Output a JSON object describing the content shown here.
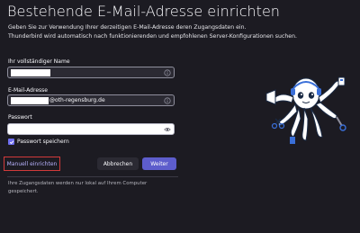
{
  "header": {
    "title": "Bestehende E-Mail-Adresse einrichten",
    "intro_line1": "Geben Sie zur Verwendung Ihrer derzeitigen E-Mail-Adresse deren Zugangsdaten ein.",
    "intro_line2": "Thunderbird wird automatisch nach funktionierenden und empfohlenen Server-Konfigurationen suchen."
  },
  "form": {
    "name_label": "Ihr vollständiger Name",
    "email_label": "E-Mail-Adresse",
    "email_domain": "@oth-regensburg.de",
    "password_label": "Passwort",
    "remember_label": "Passwort speichern",
    "remember_checked": true
  },
  "actions": {
    "manual_label": "Manuell einrichten",
    "cancel_label": "Abbrechen",
    "next_label": "Weiter"
  },
  "footer": {
    "note": "Ihre Zugangsdaten werden nur lokal auf Ihrem Computer gespeichert."
  },
  "colors": {
    "background": "#1c1b22",
    "accent": "#5d5dcc",
    "highlight_border": "#d23a3a",
    "link": "#b9b3ff"
  },
  "icons": {
    "name_field": "info-icon",
    "email_field": "info-icon",
    "password_field": "eye-icon",
    "checkbox": "check-icon"
  }
}
